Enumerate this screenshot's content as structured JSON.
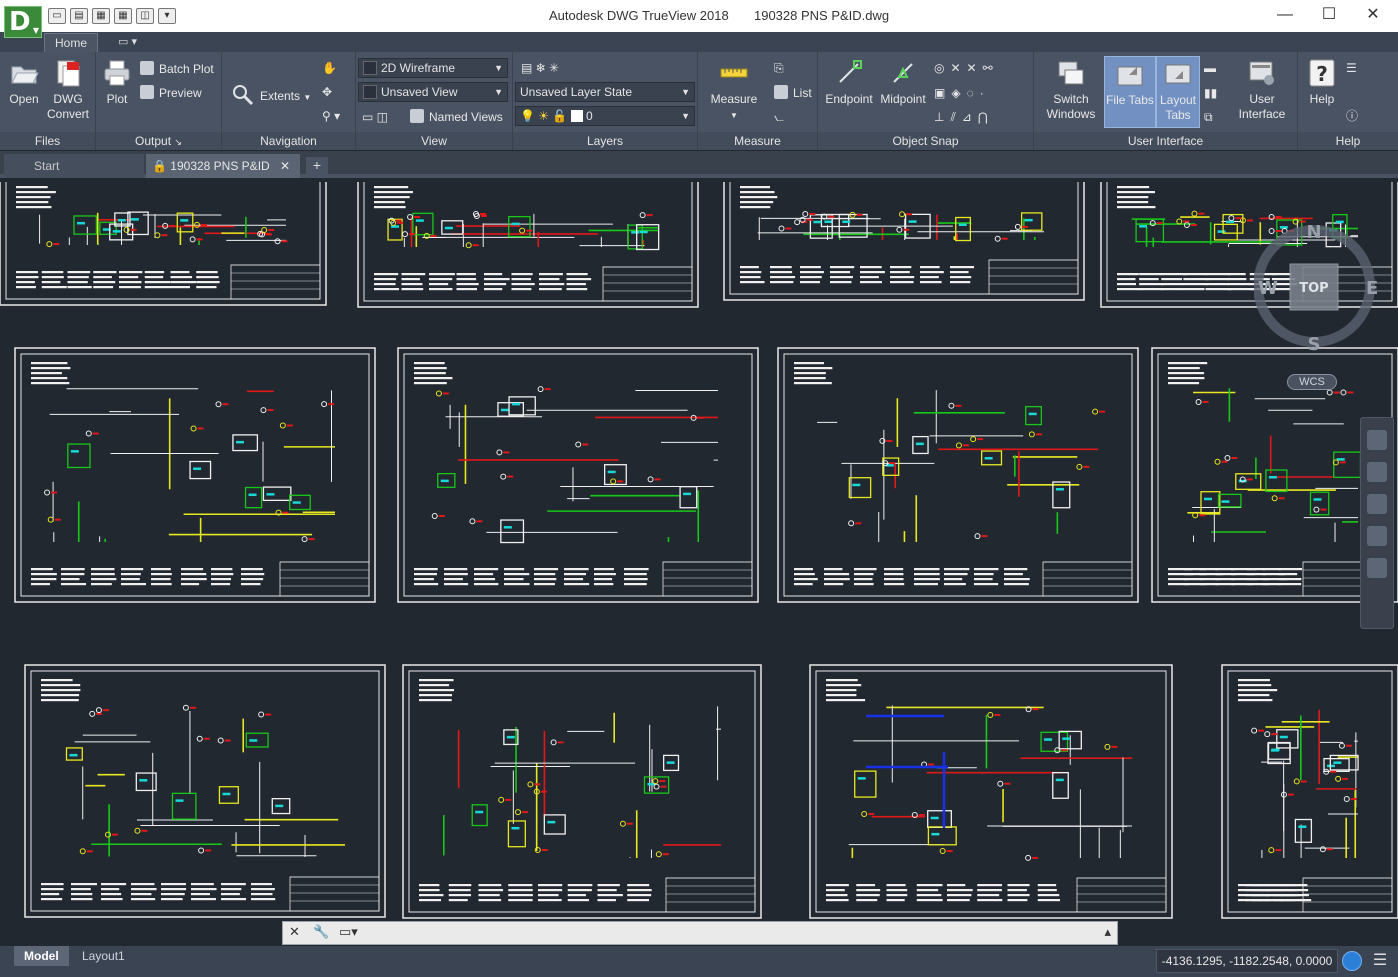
{
  "app": {
    "icon_letter": "D",
    "title": "Autodesk DWG TrueView 2018",
    "document": "190328 PNS P&ID.dwg",
    "window_controls": [
      "minimize",
      "maximize",
      "close"
    ]
  },
  "ribbon_tabs": [
    "Home"
  ],
  "ribbon": {
    "files": {
      "title": "Files",
      "open": "Open",
      "dwg_convert_1": "DWG",
      "dwg_convert_2": "Convert"
    },
    "output": {
      "title": "Output",
      "plot": "Plot",
      "batch_plot": "Batch Plot",
      "preview": "Preview"
    },
    "navigation": {
      "title": "Navigation",
      "extents": "Extents"
    },
    "view": {
      "title": "View",
      "visual_style": "2D Wireframe",
      "named_view": "Unsaved View",
      "named_views": "Named Views"
    },
    "layers": {
      "title": "Layers",
      "layer_state": "Unsaved Layer State",
      "current_layer": "0"
    },
    "measure": {
      "title": "Measure",
      "measure": "Measure",
      "list": "List"
    },
    "object_snap": {
      "title": "Object Snap",
      "endpoint": "Endpoint",
      "midpoint": "Midpoint"
    },
    "user_interface": {
      "title": "User Interface",
      "switch_1": "Switch",
      "switch_2": "Windows",
      "file_tabs": "File Tabs",
      "layout_1": "Layout",
      "layout_2": "Tabs",
      "ui_1": "User",
      "ui_2": "Interface"
    },
    "help": {
      "title": "Help",
      "help": "Help"
    }
  },
  "file_tabs": {
    "start": "Start",
    "current": "190328 PNS P&ID",
    "plus": "+"
  },
  "viewcube": {
    "north": "N",
    "south": "S",
    "west": "W",
    "east": "E",
    "face": "TOP",
    "wcs": "WCS"
  },
  "layout_tabs": [
    "Model",
    "Layout1"
  ],
  "status": {
    "coordinates": "-4136.1295, -1182.2548, 0.0000"
  },
  "colors": {
    "background": "#212830",
    "sheet_border": "#e8e8e8",
    "red": "#e01818",
    "yellow": "#e8e820",
    "green": "#18c818",
    "cyan": "#18d8d8",
    "white": "#f0f0f0",
    "blue": "#1830e8"
  }
}
